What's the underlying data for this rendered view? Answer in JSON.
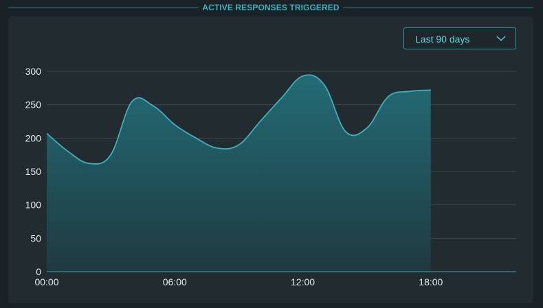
{
  "header": {
    "title": "ACTIVE RESPONSES TRIGGERED"
  },
  "filter": {
    "selected": "Last 90 days",
    "icon": "chevron-down-icon"
  },
  "colors": {
    "accent": "#39b3bd",
    "line": "#3fb0bb",
    "fill_top": "#236f79",
    "fill_bottom": "#1f3a41",
    "grid": "#3a474d",
    "axis": "#3fa6ad",
    "tick_text": "#e6ecef"
  },
  "chart_data": {
    "type": "area",
    "title": "ACTIVE RESPONSES TRIGGERED",
    "xlabel": "",
    "ylabel": "",
    "x": [
      "00:00",
      "01:00",
      "02:00",
      "03:00",
      "04:00",
      "05:00",
      "06:00",
      "07:00",
      "08:00",
      "09:00",
      "10:00",
      "11:00",
      "12:00",
      "13:00",
      "14:00",
      "15:00",
      "16:00",
      "17:00",
      "18:00"
    ],
    "values": [
      207,
      180,
      162,
      175,
      255,
      248,
      220,
      200,
      185,
      190,
      225,
      260,
      293,
      280,
      210,
      215,
      262,
      270,
      272
    ],
    "x_ticks": [
      "00:00",
      "06:00",
      "12:00",
      "18:00"
    ],
    "x_range_hours": [
      0,
      22
    ],
    "y_ticks": [
      0,
      50,
      100,
      150,
      200,
      250,
      300
    ],
    "ylim": [
      0,
      300
    ],
    "grid": true,
    "legend": "none"
  }
}
